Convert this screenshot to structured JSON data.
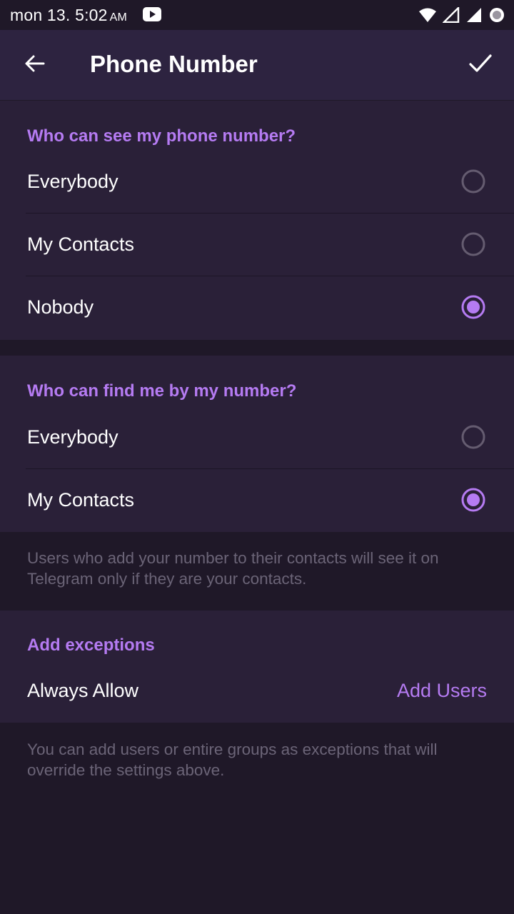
{
  "status_bar": {
    "time": "mon 13. 5:02",
    "ampm": "AM"
  },
  "toolbar": {
    "title": "Phone Number"
  },
  "colors": {
    "accent": "#b57bf2",
    "background": "#1f1828",
    "section": "#2a2038",
    "toolbar": "#2d2340",
    "hint": "#6b6477"
  },
  "see_section": {
    "header": "Who can see my phone number?",
    "options": [
      {
        "label": "Everybody",
        "selected": false
      },
      {
        "label": "My Contacts",
        "selected": false
      },
      {
        "label": "Nobody",
        "selected": true
      }
    ]
  },
  "find_section": {
    "header": "Who can find me by my number?",
    "options": [
      {
        "label": "Everybody",
        "selected": false
      },
      {
        "label": "My Contacts",
        "selected": true
      }
    ],
    "hint": "Users who add your number to their contacts will see it on Telegram only if they are your contacts."
  },
  "exceptions_section": {
    "header": "Add exceptions",
    "row_label": "Always Allow",
    "action": "Add Users",
    "hint": "You can add users or entire groups as exceptions that will override the settings above."
  }
}
